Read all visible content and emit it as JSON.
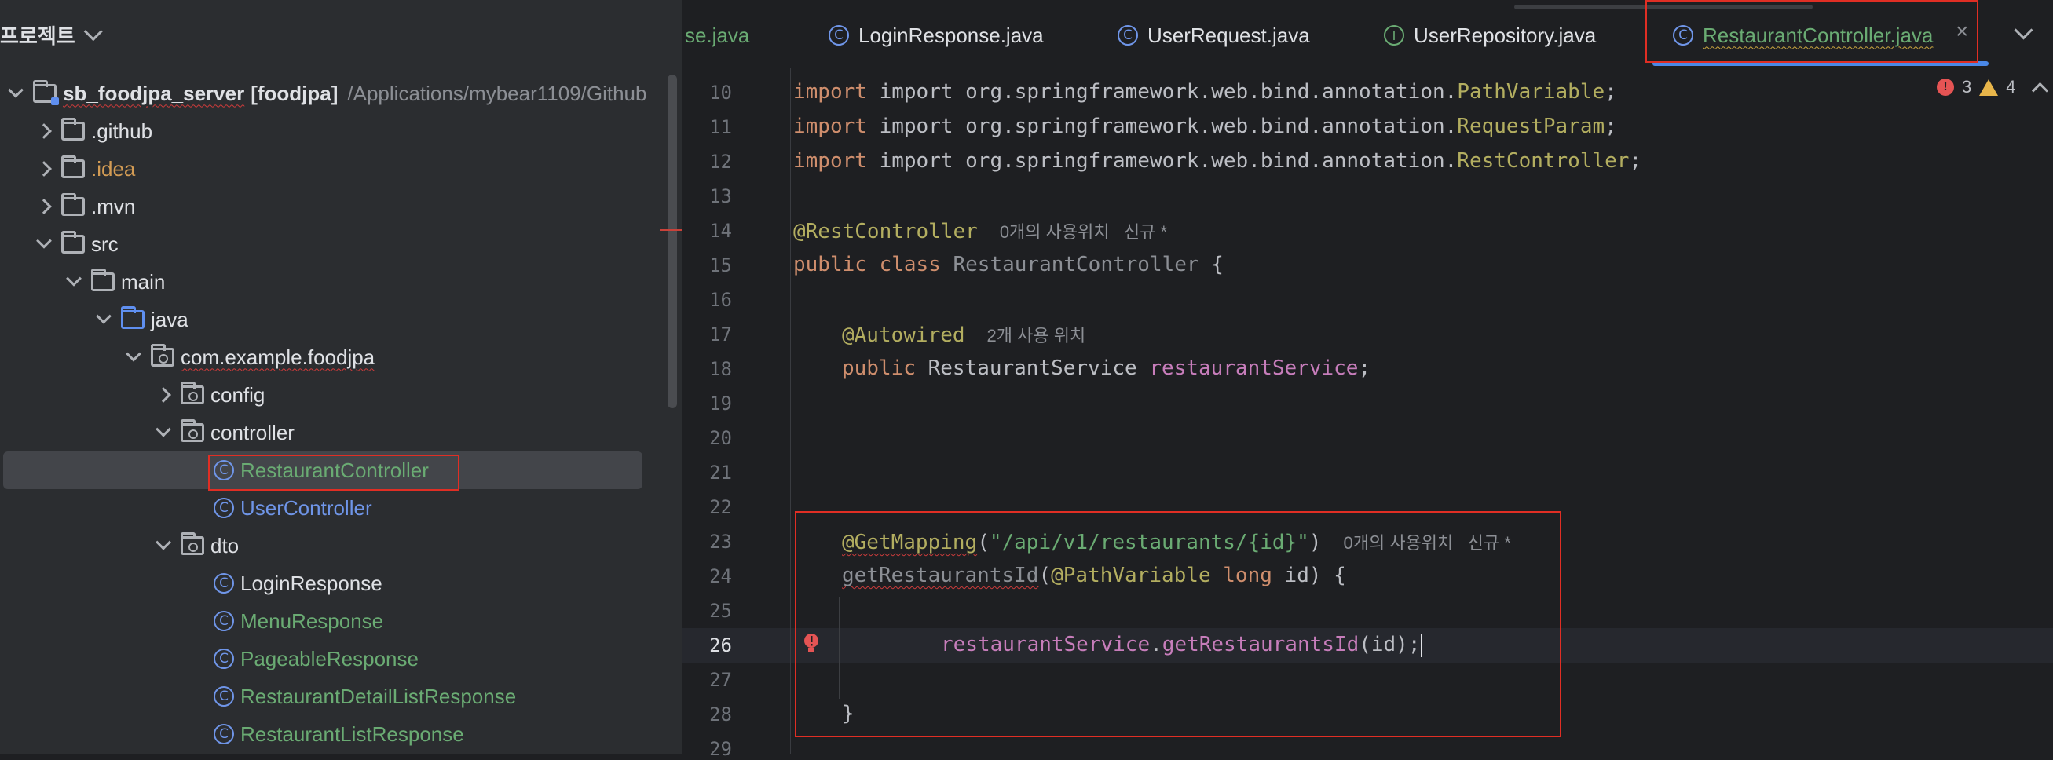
{
  "project": {
    "title": "프로젝트",
    "root": {
      "name": "sb_foodjpa_server",
      "module": "[foodjpa]",
      "path": "/Applications/mybear1109/Github"
    },
    "items": [
      {
        "label": ".github"
      },
      {
        "label": ".idea"
      },
      {
        "label": ".mvn"
      },
      {
        "label": "src"
      },
      {
        "label": "main"
      },
      {
        "label": "java"
      },
      {
        "label": "com.example.foodjpa"
      },
      {
        "label": "config"
      },
      {
        "label": "controller"
      },
      {
        "label": "RestaurantController"
      },
      {
        "label": "UserController"
      },
      {
        "label": "dto"
      },
      {
        "label": "LoginResponse"
      },
      {
        "label": "MenuResponse"
      },
      {
        "label": "PageableResponse"
      },
      {
        "label": "RestaurantDetailListResponse"
      },
      {
        "label": "RestaurantListResponse"
      }
    ]
  },
  "tabs": [
    {
      "label": "se.java"
    },
    {
      "label": "LoginResponse.java"
    },
    {
      "label": "UserRequest.java"
    },
    {
      "label": "UserRepository.java"
    },
    {
      "label": "RestaurantController.java"
    }
  ],
  "icons": {
    "class": "C",
    "interface": "I"
  },
  "status": {
    "errors": "3",
    "warnings": "4"
  },
  "editor": {
    "line_numbers": [
      "10",
      "11",
      "12",
      "13",
      "14",
      "15",
      "16",
      "17",
      "18",
      "19",
      "20",
      "21",
      "22",
      "23",
      "24",
      "25",
      "26",
      "27",
      "28",
      "29"
    ],
    "l10_pre": "import org.springframework.web.bind.annotation.",
    "l10_cls": "PathVariable",
    "l11_pre": "import org.springframework.web.bind.annotation.",
    "l11_cls": "RequestParam",
    "l12_pre": "import org.springframework.web.bind.annotation.",
    "l12_cls": "RestController",
    "semi": ";",
    "l14_ann": "@RestController",
    "l14_hint": "0개의 사용위치   신규 *",
    "l15_kw": "public class ",
    "l15_name": "RestaurantController",
    "l15_rest": " {",
    "l17_ann": "@Autowired",
    "l17_hint": "2개 사용 위치",
    "l18_kw": "public ",
    "l18_type": "RestaurantService ",
    "l18_field": "restaurantService",
    "l23_ann": "@GetMapping",
    "l23_open": "(",
    "l23_str": "\"/api/v1/restaurants/{id}\"",
    "l23_close": ")",
    "l23_hint": "0개의 사용위치   신규 *",
    "l24_name": "getRestaurantsId",
    "l24_open": "(",
    "l24_ann": "@PathVariable ",
    "l24_kw": "long ",
    "l24_rest": "id) {",
    "l26_field": "restaurantService",
    "l26_dot": ".",
    "l26_method": "getRestaurantsId",
    "l26_rest": "(id);",
    "l28": "}"
  }
}
